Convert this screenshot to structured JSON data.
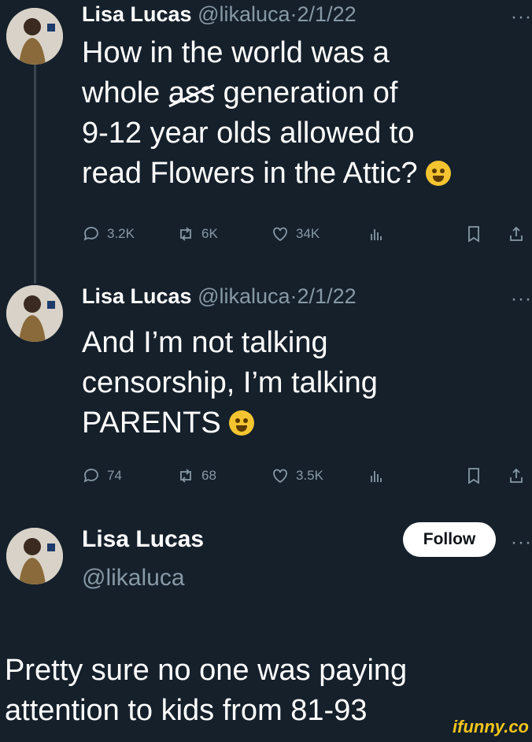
{
  "tweets": [
    {
      "name": "Lisa Lucas",
      "handle": "@likaluca",
      "date": "2/1/22",
      "lines": [
        "How in the world was a",
        "whole",
        "ass",
        "generation of",
        "9-12 year olds allowed to",
        "read Flowers in the Attic?"
      ],
      "stats": {
        "replies": "3.2K",
        "retweets": "6K",
        "likes": "34K"
      }
    },
    {
      "name": "Lisa Lucas",
      "handle": "@likaluca",
      "date": "2/1/22",
      "lines": [
        "And I’m not talking",
        "censorship, I’m talking",
        "PARENTS"
      ],
      "stats": {
        "replies": "74",
        "retweets": "68",
        "likes": "3.5K"
      }
    }
  ],
  "profile": {
    "name": "Lisa Lucas",
    "handle": "@likaluca",
    "follow_label": "Follow"
  },
  "separator": "·",
  "more_label": "···",
  "comment": {
    "lines": [
      "Pretty sure no one was paying",
      "attention to kids from 81-93"
    ]
  },
  "watermark": "ifunny.co",
  "icons": {
    "reply": "reply-icon",
    "retweet": "retweet-icon",
    "like": "heart-icon",
    "views": "views-icon",
    "bookmark": "bookmark-icon",
    "share": "share-icon"
  },
  "colors": {
    "background": "#15202b",
    "muted": "#8899a6",
    "text": "#ffffff",
    "watermark": "#f5c518"
  }
}
